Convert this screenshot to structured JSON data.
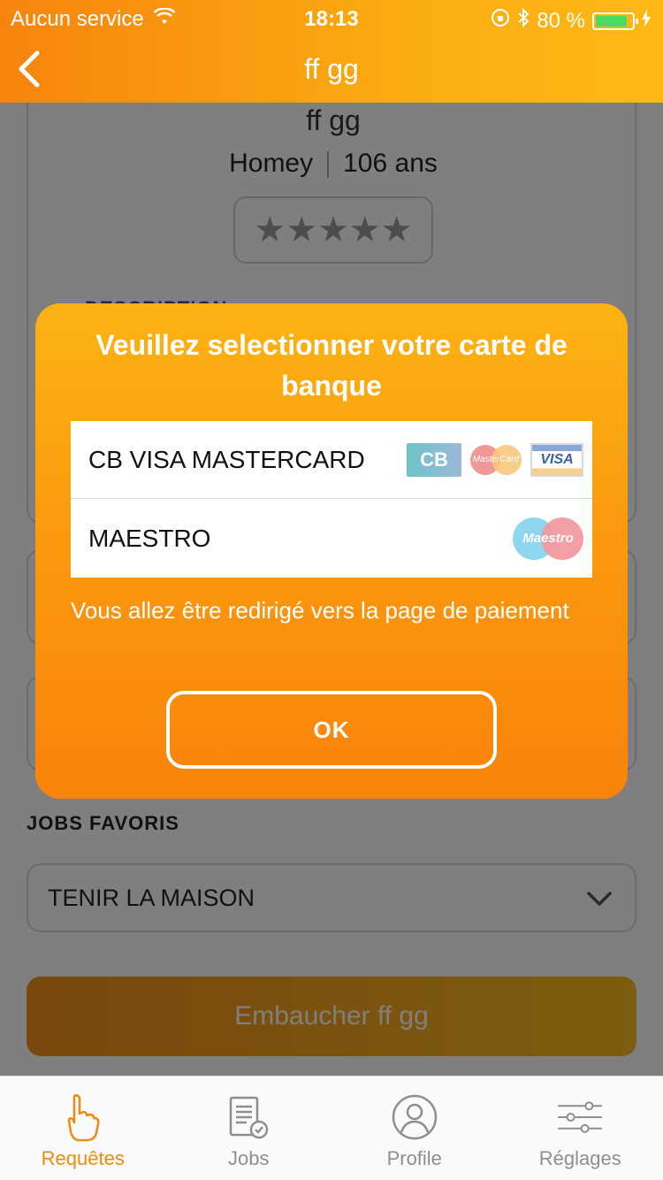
{
  "status_bar": {
    "carrier": "Aucun service",
    "time": "18:13",
    "battery_percent": "80 %"
  },
  "nav": {
    "title": "ff gg"
  },
  "profile": {
    "name": "ff gg",
    "city": "Homey",
    "age": "106 ans",
    "rating": "★★★★★",
    "description_label": "DESCRIPTION"
  },
  "favorites": {
    "label": "JOBS FAVORIS",
    "selected": "TENIR LA MAISON"
  },
  "hire_button": "Embaucher ff gg",
  "modal": {
    "title": "Veuillez selectionner votre carte de banque",
    "options": [
      {
        "label": "CB VISA MASTERCARD",
        "logos": [
          "cb-logo",
          "mastercard-logo",
          "visa-logo"
        ]
      },
      {
        "label": "MAESTRO",
        "logos": [
          "maestro-logo"
        ]
      }
    ],
    "logo_text": {
      "cb": "CB",
      "mastercard": "MasterCard",
      "visa": "VISA",
      "maestro": "Maestro"
    },
    "note": "Vous allez être redirigé vers la page de paiement",
    "ok_label": "OK"
  },
  "tabs": [
    {
      "label": "Requêtes",
      "icon": "hand-pointer-icon",
      "active": true
    },
    {
      "label": "Jobs",
      "icon": "document-check-icon",
      "active": false
    },
    {
      "label": "Profile",
      "icon": "user-circle-icon",
      "active": false
    },
    {
      "label": "Réglages",
      "icon": "sliders-icon",
      "active": false
    }
  ],
  "colors": {
    "accent": "#f7840e",
    "accent_light": "#feb914",
    "active_tab": "#f28a0e",
    "inactive_tab": "#8e8e93"
  }
}
